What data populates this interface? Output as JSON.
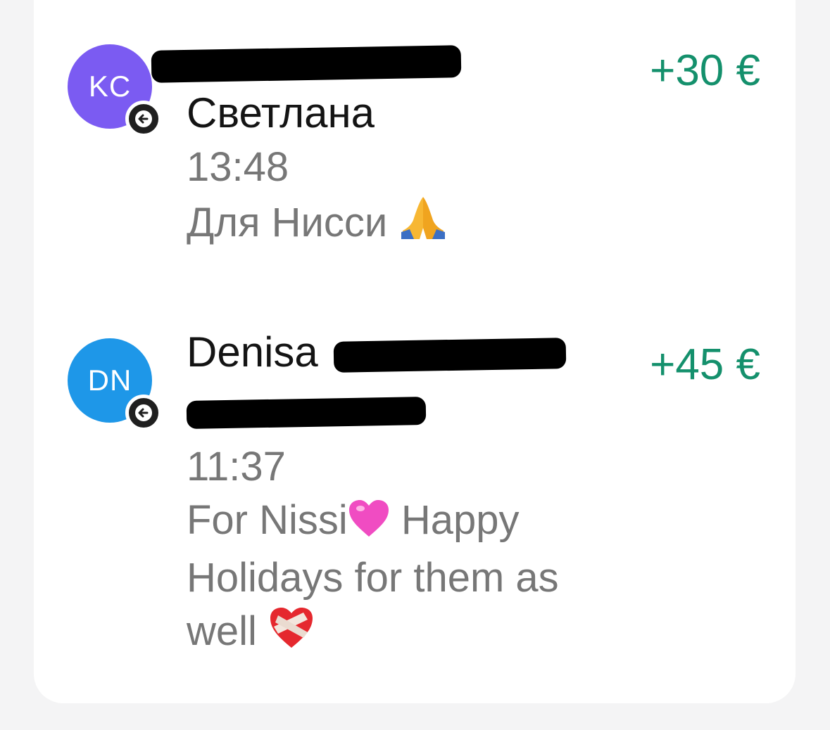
{
  "transactions": [
    {
      "initials": "KC",
      "avatar_color": "#7b5bf2",
      "direction_icon": "arrow-left-icon",
      "name_line2": "Светлана",
      "time": "13:48",
      "comment": "Для Нисси",
      "comment_emoji": "folded-hands-emoji",
      "amount": "+30 €"
    },
    {
      "initials": "DN",
      "avatar_color": "#1e97e8",
      "direction_icon": "arrow-left-icon",
      "name_line1": "Denisa",
      "time": "11:37",
      "comment_part1": "For Nissi",
      "comment_emoji1": "pink-heart-emoji",
      "comment_part2": " Happy Holidays for them as well",
      "comment_emoji2": "mending-heart-emoji",
      "amount": "+45 €"
    }
  ],
  "colors": {
    "amount_positive": "#14906c",
    "secondary_text": "#777777",
    "primary_text": "#141414"
  }
}
